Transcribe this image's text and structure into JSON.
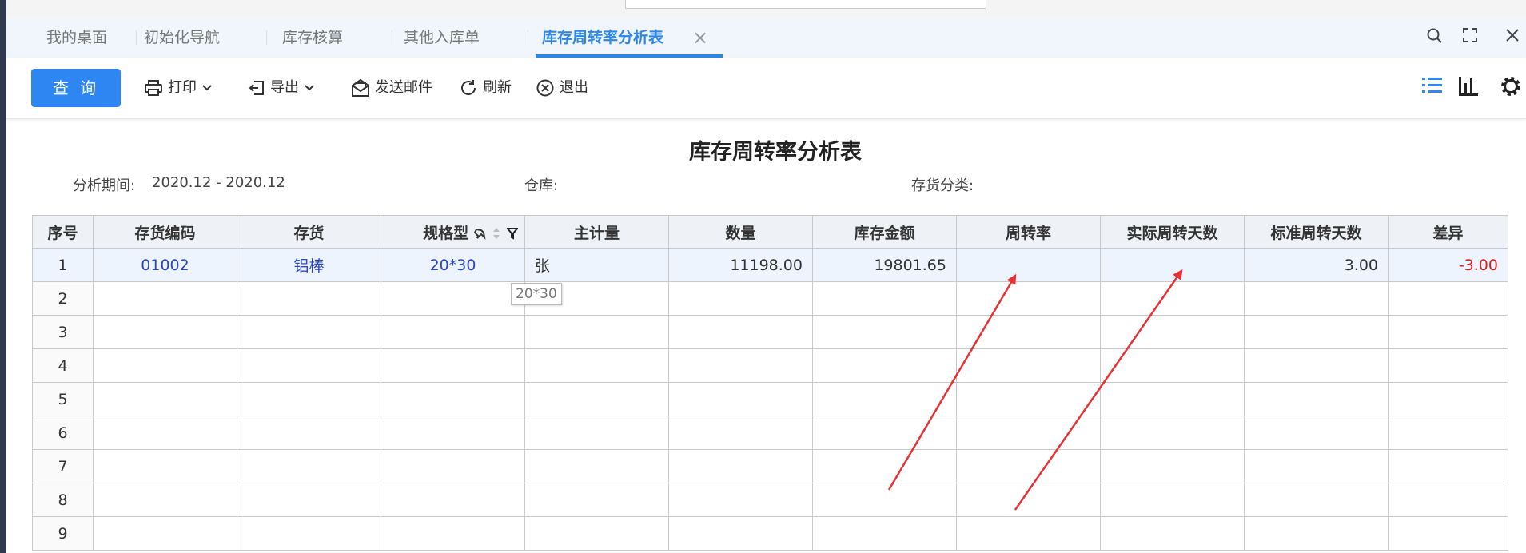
{
  "tabs": [
    {
      "label": "我的桌面"
    },
    {
      "label": "初始化导航"
    },
    {
      "label": "库存核算"
    },
    {
      "label": "其他入库单"
    },
    {
      "label": "库存周转率分析表",
      "active": true
    }
  ],
  "toolbar": {
    "query_label": "查 询",
    "print_label": "打印",
    "export_label": "导出",
    "mail_label": "发送邮件",
    "refresh_label": "刷新",
    "exit_label": "退出"
  },
  "report": {
    "title": "库存周转率分析表",
    "period_label": "分析期间:",
    "period_value": "2020.12 - 2020.12",
    "warehouse_label": "仓库:",
    "category_label": "存货分类:"
  },
  "table": {
    "columns": [
      "序号",
      "存货编码",
      "存货",
      "规格型",
      "主计量",
      "数量",
      "库存金额",
      "周转率",
      "实际周转天数",
      "标准周转天数",
      "差异"
    ],
    "rows": [
      [
        "1",
        "01002",
        "铝棒",
        "20*30",
        "张",
        "11198.00",
        "19801.65",
        "",
        "",
        "3.00",
        "-3.00"
      ],
      [
        "2",
        "",
        "",
        "",
        "",
        "",
        "",
        "",
        "",
        "",
        ""
      ],
      [
        "3",
        "",
        "",
        "",
        "",
        "",
        "",
        "",
        "",
        "",
        ""
      ],
      [
        "4",
        "",
        "",
        "",
        "",
        "",
        "",
        "",
        "",
        "",
        ""
      ],
      [
        "5",
        "",
        "",
        "",
        "",
        "",
        "",
        "",
        "",
        "",
        ""
      ],
      [
        "6",
        "",
        "",
        "",
        "",
        "",
        "",
        "",
        "",
        "",
        ""
      ],
      [
        "7",
        "",
        "",
        "",
        "",
        "",
        "",
        "",
        "",
        "",
        ""
      ],
      [
        "8",
        "",
        "",
        "",
        "",
        "",
        "",
        "",
        "",
        "",
        ""
      ],
      [
        "9",
        "",
        "",
        "",
        "",
        "",
        "",
        "",
        "",
        "",
        ""
      ]
    ]
  },
  "tooltip": {
    "text": "20*30"
  },
  "colors": {
    "accent": "#2d86f2",
    "negative": "#e21b1b",
    "link": "#2a46c9",
    "annotation": "#e63232"
  }
}
